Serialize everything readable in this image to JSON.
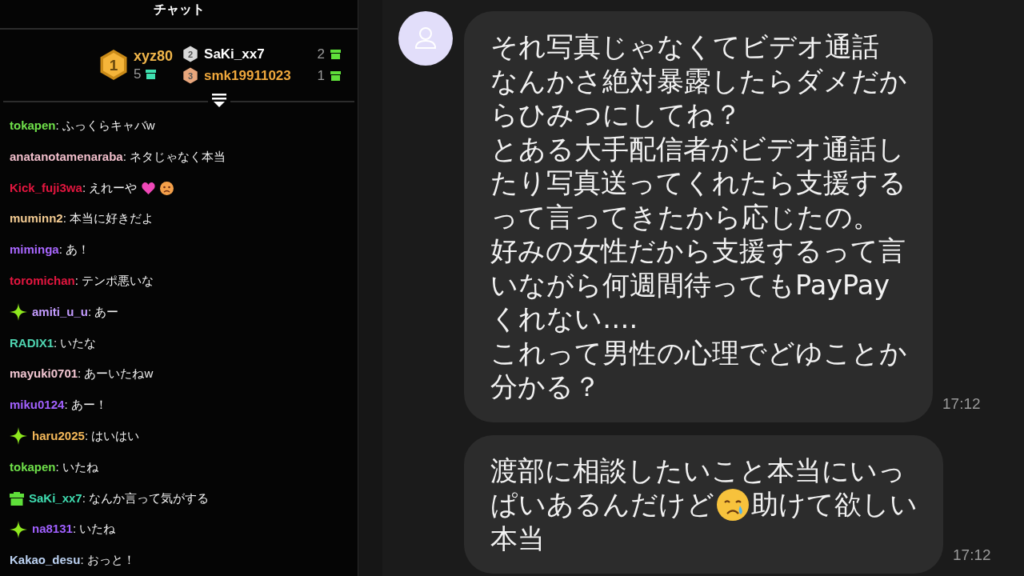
{
  "chat": {
    "title": "チャット",
    "leaderboard": [
      {
        "rank": "1",
        "name": "xyz80",
        "count": "5",
        "color": "#f0b54a"
      },
      {
        "rank": "2",
        "name": "SaKi_xx7",
        "count": "2",
        "color": "#ffffff"
      },
      {
        "rank": "3",
        "name": "smk19911023",
        "count": "1",
        "color": "#f0a83c"
      }
    ],
    "messages": [
      {
        "kind": "plain",
        "user": "tokapen",
        "color": "#6fe04a",
        "text": ": ふっくらキャバw"
      },
      {
        "kind": "plain",
        "user": "anatanotamenaraba",
        "color": "#f2bfcc",
        "text": ": ネタじゃなく本当"
      },
      {
        "kind": "reaction",
        "user": "Kick_fuji3wa",
        "color": "#e3163f",
        "text": ": えれーや"
      },
      {
        "kind": "plain",
        "user": "muminn2",
        "color": "#f3cb92",
        "text": ": 本当に好きだよ"
      },
      {
        "kind": "plain",
        "user": "miminga",
        "color": "#a967ff",
        "text": ": あ！"
      },
      {
        "kind": "plain",
        "user": "toromichan",
        "color": "#e3163f",
        "text": ": テンポ悪いな"
      },
      {
        "kind": "sparkle",
        "user": "amiti_u_u",
        "color": "#c49cff",
        "text": ": あー"
      },
      {
        "kind": "plain",
        "user": "RADIX1",
        "color": "#4fd5b1",
        "text": ": いたな"
      },
      {
        "kind": "plain",
        "user": "mayuki0701",
        "color": "#f2c6d2",
        "text": ": あーいたねw"
      },
      {
        "kind": "plain",
        "user": "miku0124",
        "color": "#a261ff",
        "text": ": あー！"
      },
      {
        "kind": "sparkle",
        "user": "haru2025",
        "color": "#f5b95a",
        "text": ": はいはい"
      },
      {
        "kind": "plain",
        "user": "tokapen",
        "color": "#6fe04a",
        "text": ": いたね"
      },
      {
        "kind": "gift",
        "user": "SaKi_xx7",
        "color": "#3fdcb0",
        "text": ": なんか言って気がする"
      },
      {
        "kind": "sparkle",
        "user": "na8131",
        "color": "#a060ff",
        "text": ": いたね"
      },
      {
        "kind": "plain",
        "user": "Kakao_desu",
        "color": "#bcd2f2",
        "text": ": おっと！"
      }
    ]
  },
  "conversation": [
    {
      "avatar": true,
      "time": "17:12",
      "lines": [
        [
          {
            "kind": "text",
            "text": "それ写真じゃなくてビデオ通話"
          }
        ],
        [
          {
            "kind": "text",
            "text": "なんかさ絶対暴露したらダメだか"
          }
        ],
        [
          {
            "kind": "text",
            "text": "らひみつにしてね？"
          }
        ],
        [
          {
            "kind": "text",
            "text": "とある大手配信者がビデオ通話し"
          }
        ],
        [
          {
            "kind": "text",
            "text": "たり写真送ってくれたら支援する"
          }
        ],
        [
          {
            "kind": "text",
            "text": "って言ってきたから応じたの。"
          }
        ],
        [
          {
            "kind": "text",
            "text": "好みの女性だから支援するって言"
          }
        ],
        [
          {
            "kind": "text",
            "text": "いながら何週間待ってもPayPay"
          }
        ],
        [
          {
            "kind": "text",
            "text": "くれない…."
          }
        ],
        [
          {
            "kind": "text",
            "text": "これって男性の心理でどゆことか"
          }
        ],
        [
          {
            "kind": "text",
            "text": "分かる？"
          }
        ]
      ]
    },
    {
      "avatar": false,
      "time": "17:12",
      "lines": [
        [
          {
            "kind": "text",
            "text": "渡部に相談したいこと本当にいっ"
          }
        ],
        [
          {
            "kind": "text",
            "text": "ぱいあるんだけど"
          },
          {
            "kind": "crying"
          },
          {
            "kind": "text",
            "text": "助けて欲しい"
          }
        ],
        [
          {
            "kind": "text",
            "text": "本当"
          }
        ]
      ]
    }
  ]
}
